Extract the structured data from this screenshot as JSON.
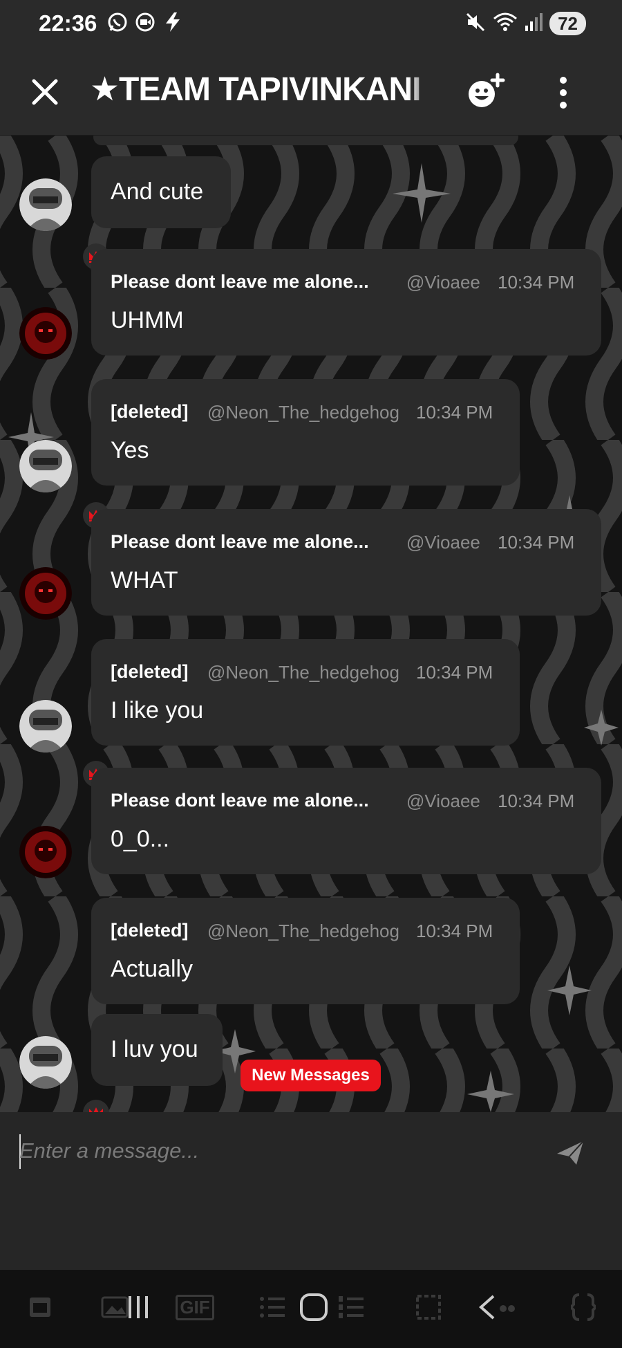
{
  "status_bar": {
    "time": "22:36",
    "battery": "72"
  },
  "header": {
    "title": "★TEAM TAPIVINKANI"
  },
  "messages": [
    {
      "kind": "continuation",
      "text": "And cute"
    },
    {
      "kind": "full",
      "author": "Please dont leave me alone...",
      "handle": "@Vioaee",
      "time": "10:34 PM",
      "text": "UHMM"
    },
    {
      "kind": "full",
      "author": "[deleted]",
      "handle": "@Neon_The_hedgehog",
      "time": "10:34 PM",
      "text": "Yes"
    },
    {
      "kind": "full",
      "author": "Please dont leave me alone...",
      "handle": "@Vioaee",
      "time": "10:34 PM",
      "text": "WHAT"
    },
    {
      "kind": "full",
      "author": "[deleted]",
      "handle": "@Neon_The_hedgehog",
      "time": "10:34 PM",
      "text": "I like you"
    },
    {
      "kind": "full",
      "author": "Please dont leave me alone...",
      "handle": "@Vioaee",
      "time": "10:34 PM",
      "text": "0_0..."
    },
    {
      "kind": "full",
      "author": "[deleted]",
      "handle": "@Neon_The_hedgehog",
      "time": "10:34 PM",
      "text": "Actually"
    },
    {
      "kind": "continuation",
      "text": "I luv you"
    }
  ],
  "new_messages_label": "New Messages",
  "composer": {
    "placeholder": "Enter a message..."
  },
  "toolbar": {
    "gif_label": "GIF"
  },
  "colors": {
    "accent_red": "#e8141c",
    "bubble": "#2b2b2b",
    "header": "#2a2a2a"
  }
}
